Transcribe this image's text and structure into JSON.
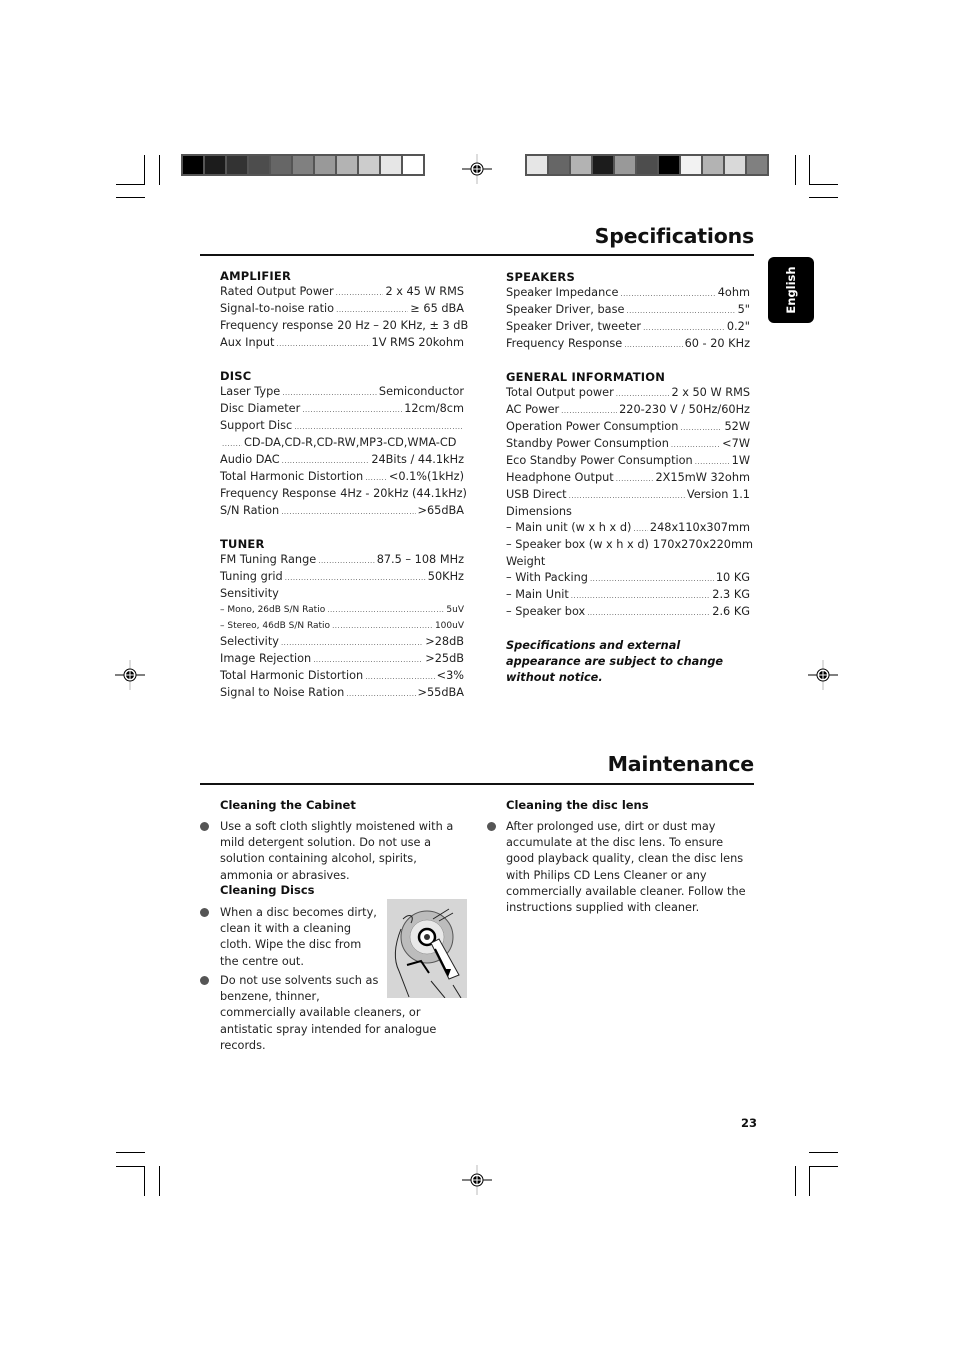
{
  "colors": {
    "bar_left": [
      "#000000",
      "#1c1c1c",
      "#333333",
      "#4d4d4d",
      "#666666",
      "#808080",
      "#999999",
      "#b3b3b3",
      "#cccccc",
      "#e6e6e6",
      "#ffffff"
    ],
    "bar_right": [
      "#e6e6e6",
      "#666666",
      "#b3b3b3",
      "#1c1c1c",
      "#999999",
      "#4d4d4d",
      "#000000",
      "#f2f2f2",
      "#b3b3b3",
      "#d9d9d9",
      "#808080"
    ]
  },
  "language_tab": "English",
  "specifications": {
    "title": "Specifications",
    "amplifier": {
      "heading": "AMPLIFIER",
      "rows": [
        {
          "label": "Rated Output Power",
          "value": "2 x 45 W RMS"
        },
        {
          "label": "Signal-to-noise ratio",
          "value": "≥ 65 dBA"
        },
        {
          "label": "Frequency response",
          "value": "20 Hz – 20 KHz, ± 3 dB"
        },
        {
          "label": "Aux Input",
          "value": "1V RMS 20kohm"
        }
      ]
    },
    "disc": {
      "heading": "DISC",
      "rows": [
        {
          "label": "Laser Type",
          "value": "Semiconductor"
        },
        {
          "label": "Disc Diameter",
          "value": "12cm/8cm"
        },
        {
          "label": "Support Disc",
          "value": ""
        },
        {
          "label": "",
          "value": "CD-DA,CD-R,CD-RW,MP3-CD,WMA-CD"
        },
        {
          "label": "Audio DAC",
          "value": "24Bits / 44.1kHz"
        },
        {
          "label": "Total Harmonic Distortion",
          "value": "<0.1%(1kHz)"
        },
        {
          "label": "Frequency Response",
          "value": "4Hz - 20kHz (44.1kHz)"
        },
        {
          "label": "S/N Ration",
          "value": ">65dBA"
        }
      ]
    },
    "tuner": {
      "heading": "TUNER",
      "rows": [
        {
          "label": "FM Tuning Range",
          "value": "87.5 – 108 MHz"
        },
        {
          "label": "Tuning grid",
          "value": "50KHz"
        },
        {
          "label": "Sensitivity",
          "value": ""
        },
        {
          "label": "– Mono, 26dB S/N Ratio",
          "value": "5uV"
        },
        {
          "label": "– Stereo, 46dB S/N Ratio",
          "value": "100uV"
        },
        {
          "label": "Selectivity",
          "value": ">28dB"
        },
        {
          "label": "Image Rejection",
          "value": ">25dB"
        },
        {
          "label": "Total Harmonic Distortion",
          "value": "<3%"
        },
        {
          "label": "Signal to Noise Ration",
          "value": ">55dBA"
        }
      ]
    },
    "speakers": {
      "heading": "SPEAKERS",
      "rows": [
        {
          "label": "Speaker Impedance",
          "value": "4ohm"
        },
        {
          "label": "Speaker Driver, base",
          "value": "5\""
        },
        {
          "label": "Speaker Driver, tweeter",
          "value": "0.2\""
        },
        {
          "label": "Frequency Response",
          "value": "60 - 20 KHz"
        }
      ]
    },
    "general": {
      "heading": "GENERAL INFORMATION",
      "rows": [
        {
          "label": "Total Output power",
          "value": "2 x 50 W RMS"
        },
        {
          "label": "AC Power",
          "value": "220-230 V / 50Hz/60Hz"
        },
        {
          "label": "Operation Power Consumption",
          "value": "52W"
        },
        {
          "label": "Standby Power Consumption",
          "value": "<7W"
        },
        {
          "label": "Eco Standby Power Consumption",
          "value": "1W"
        },
        {
          "label": "Headphone Output",
          "value": "2X15mW 32ohm"
        },
        {
          "label": "USB Direct",
          "value": "Version 1.1"
        },
        {
          "label": "Dimensions",
          "value": ""
        },
        {
          "label": "– Main unit (w x h x d)",
          "value": "248x110x307mm"
        },
        {
          "label": "– Speaker box (w x h x d)",
          "value": "170x270x220mm"
        },
        {
          "label": "Weight",
          "value": ""
        },
        {
          "label": "– With Packing",
          "value": "10 KG"
        },
        {
          "label": "– Main Unit",
          "value": "2.3 KG"
        },
        {
          "label": "– Speaker box",
          "value": "2.6 KG"
        }
      ]
    },
    "note": "Specifications and external appearance are subject to change without notice."
  },
  "maintenance": {
    "title": "Maintenance",
    "cabinet": {
      "heading": "Cleaning the Cabinet",
      "bullets": [
        "Use a soft cloth slightly moistened with a mild detergent solution. Do not use a solution containing alcohol, spirits, ammonia or abrasives."
      ]
    },
    "discs": {
      "heading": "Cleaning Discs",
      "bullets": [
        "When a disc becomes dirty, clean it with a cleaning cloth. Wipe the disc from the centre out.",
        "Do not use solvents such as benzene, thinner, commercially available cleaners, or antistatic spray intended for analogue records."
      ]
    },
    "lens": {
      "heading": "Cleaning the disc lens",
      "bullets": [
        "After prolonged use, dirt or dust may accumulate at the disc lens. To ensure good playback quality, clean the disc lens with Philips CD Lens Cleaner or any commercially available cleaner. Follow the instructions supplied with cleaner."
      ]
    }
  },
  "page_number": "23"
}
